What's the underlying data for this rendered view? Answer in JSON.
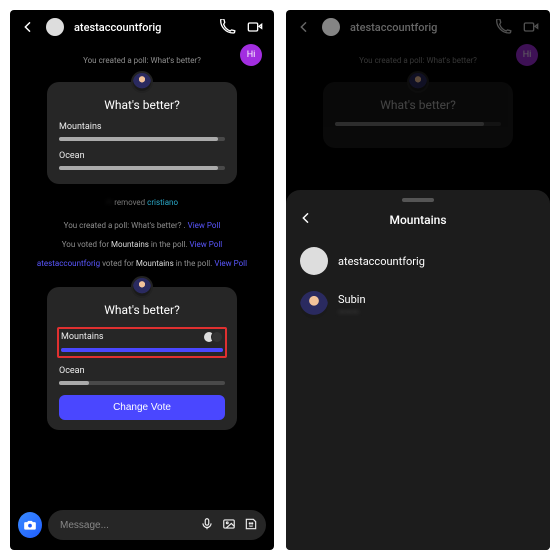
{
  "left": {
    "header": {
      "username": "atestaccountforig"
    },
    "hi_badge": "Hi",
    "sys_created": "You created a poll: What's better?",
    "poll1": {
      "title": "What's better?",
      "opt1": "Mountains",
      "opt2": "Ocean"
    },
    "removed_line_prefix": "—",
    "removed_line_action": " removed ",
    "removed_line_target": "cristiano",
    "sys_created2_pre": "You created a poll: What's better? . ",
    "view_poll": "View Poll",
    "sys_voted_pre": "You voted for ",
    "sys_voted_choice": "Mountains",
    "sys_voted_post": " in the poll. ",
    "sys_other_user": "atestaccountforig",
    "sys_other_mid": " voted for ",
    "sys_other_choice": "Mountains",
    "sys_other_post": " in the poll. ",
    "poll2": {
      "title": "What's better?",
      "opt1": "Mountains",
      "opt2": "Ocean",
      "change_vote": "Change Vote"
    },
    "composer": {
      "placeholder": "Message..."
    }
  },
  "right": {
    "header": {
      "username": "atestaccountforig"
    },
    "hi_badge": "Hi",
    "sys_created": "You created a poll: What's better?",
    "poll_bg": {
      "title": "What's better?"
    },
    "sheet": {
      "title": "Mountains",
      "voter1": "atestaccountforig",
      "voter2": "Subin",
      "voter2_sub": "———"
    }
  }
}
